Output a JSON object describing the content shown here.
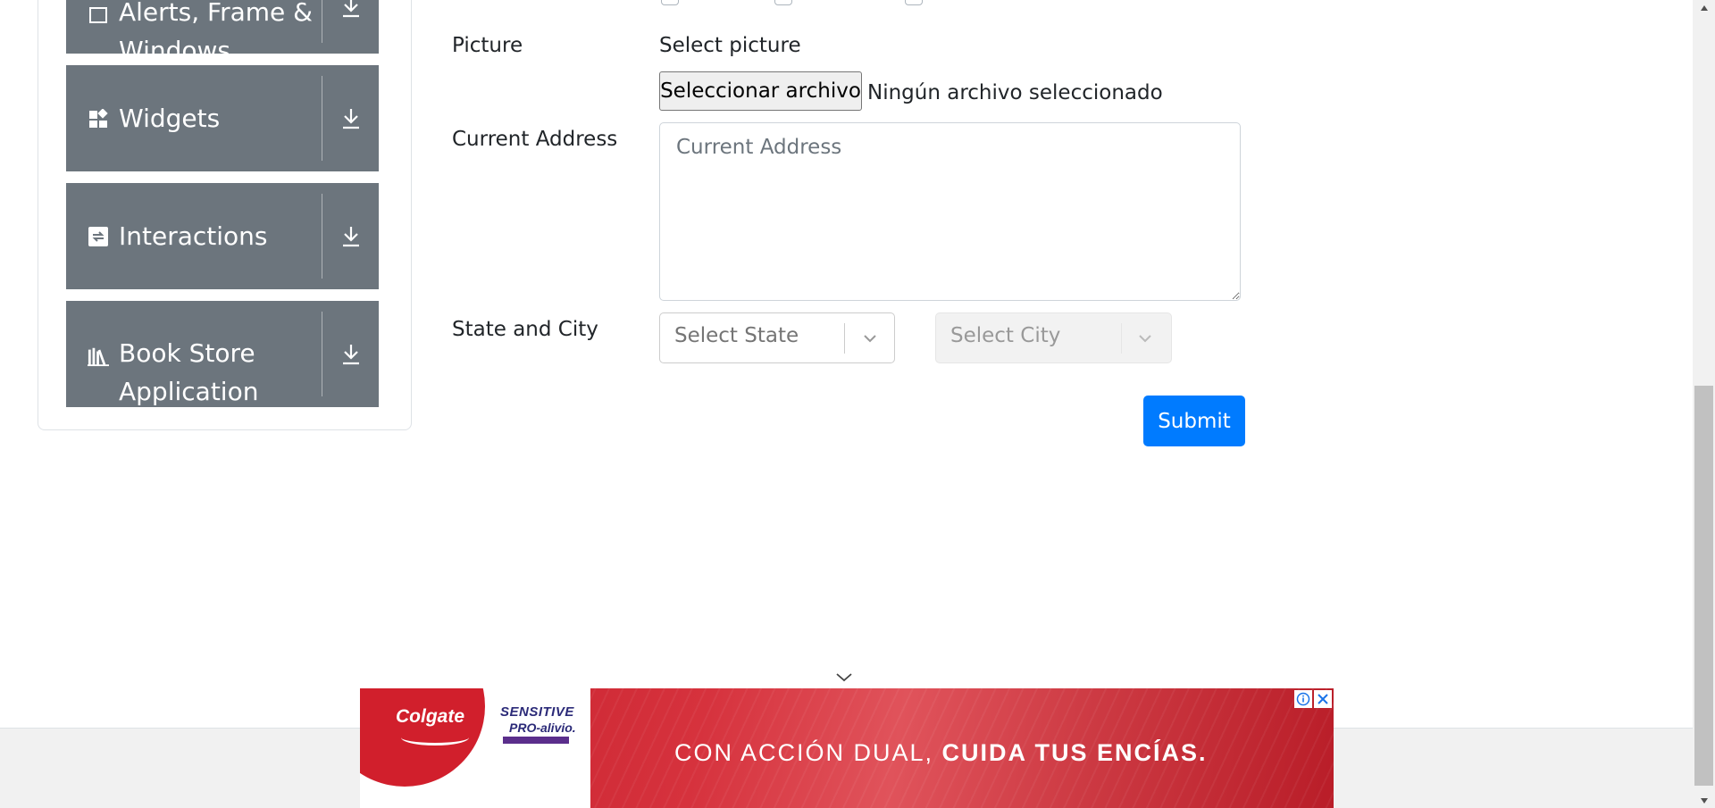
{
  "sidebar": {
    "groups": [
      {
        "label": "Alerts, Frame & Windows",
        "icon": "window-icon"
      },
      {
        "label": "Widgets",
        "icon": "widgets-icon"
      },
      {
        "label": "Interactions",
        "icon": "interactions-icon"
      },
      {
        "label": "Book Store Application",
        "icon": "books-icon"
      }
    ]
  },
  "form": {
    "picture": {
      "label": "Picture",
      "hint": "Select picture",
      "button_label": "Seleccionar archivo",
      "status": "Ningún archivo seleccionado"
    },
    "address": {
      "label": "Current Address",
      "placeholder": "Current Address",
      "value": ""
    },
    "state_city": {
      "label": "State and City",
      "state_placeholder": "Select State",
      "city_placeholder": "Select City"
    },
    "submit_label": "Submit"
  },
  "ad": {
    "brand": "Colgate",
    "product_line1": "SENSITIVE",
    "product_line2": "PRO-alivio.",
    "headline_regular": "CON ACCIÓN DUAL, ",
    "headline_bold": "CUIDA TUS ENCÍAS."
  },
  "colors": {
    "sidebar_group": "#6c757d",
    "primary": "#007bff",
    "ad_red": "#d11f2c"
  }
}
